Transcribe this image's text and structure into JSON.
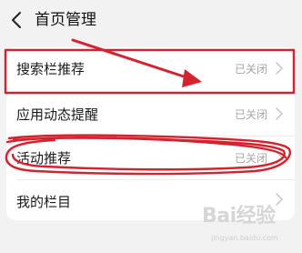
{
  "header": {
    "back_icon": "chevron-left-icon",
    "title": "首页管理"
  },
  "settings": {
    "items": [
      {
        "label": "搜索栏推荐",
        "value": "已关闭"
      },
      {
        "label": "应用动态提醒",
        "value": "已关闭"
      },
      {
        "label": "活动推荐",
        "value": "已关闭"
      },
      {
        "label": "我的栏目",
        "value": ""
      }
    ]
  },
  "annotation": {
    "color": "#d4232f"
  },
  "watermark": {
    "brand": "Bai经验",
    "url": "jingyan.baidu.com"
  }
}
